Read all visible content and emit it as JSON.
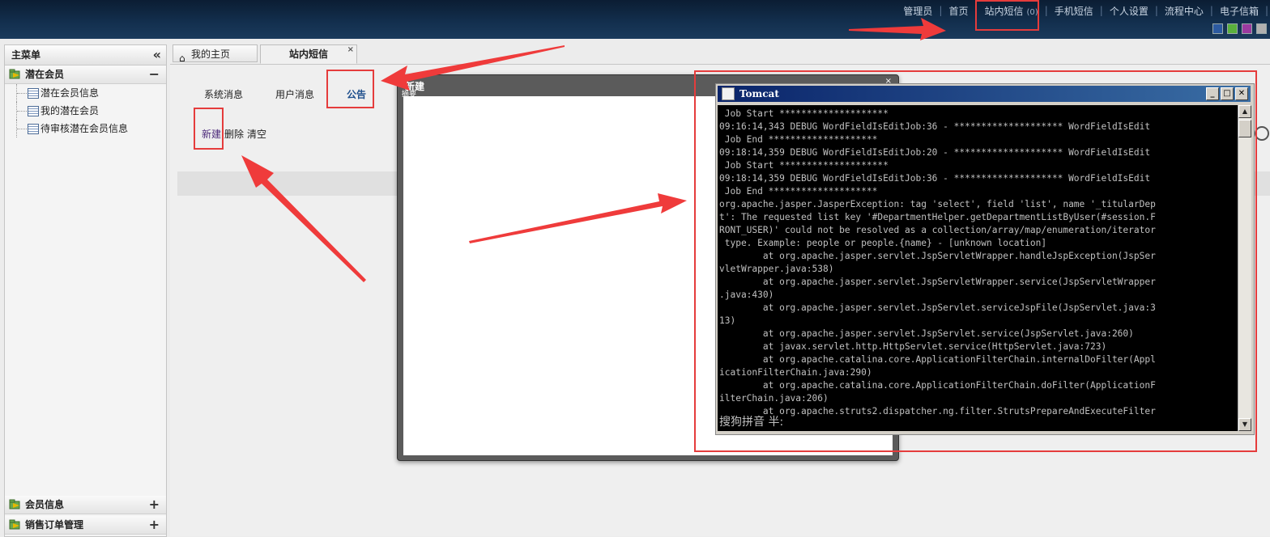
{
  "header": {
    "nav": [
      {
        "label": "管理员"
      },
      {
        "label": "首页"
      },
      {
        "label": "站内短信",
        "count": "(0)"
      },
      {
        "label": "手机短信"
      },
      {
        "label": "个人设置"
      },
      {
        "label": "流程中心"
      },
      {
        "label": "电子信箱"
      }
    ],
    "theme_colors": [
      "#2c5aa0",
      "#5ab03c",
      "#9b3aa0",
      "#b0b0b0"
    ]
  },
  "sidebar": {
    "title": "主菜单",
    "groups": [
      {
        "label": "潜在会员",
        "state": "−",
        "items": [
          {
            "label": "潜在会员信息"
          },
          {
            "label": "我的潜在会员"
          },
          {
            "label": "待审核潜在会员信息"
          }
        ]
      },
      {
        "label": "会员信息",
        "state": "+"
      },
      {
        "label": "销售订单管理",
        "state": "+"
      }
    ]
  },
  "tabs": [
    {
      "label": "我的主页"
    },
    {
      "label": "站内短信",
      "close": "×"
    }
  ],
  "message_tabs": [
    "系统消息",
    "用户消息",
    "公告"
  ],
  "actions": {
    "new": "新建",
    "delete": "删除",
    "clear": "清空"
  },
  "dialog": {
    "title": "新建",
    "subtitle": "摘要",
    "close": "×"
  },
  "console": {
    "title": "Tomcat",
    "lines": [
      " Job Start ********************",
      "09:16:14,343 DEBUG WordFieldIsEditJob:36 - ******************** WordFieldIsEdit",
      " Job End ********************",
      "09:18:14,359 DEBUG WordFieldIsEditJob:20 - ******************** WordFieldIsEdit",
      " Job Start ********************",
      "09:18:14,359 DEBUG WordFieldIsEditJob:36 - ******************** WordFieldIsEdit",
      " Job End ********************",
      "org.apache.jasper.JasperException: tag 'select', field 'list', name '_titularDep",
      "t': The requested list key '#DepartmentHelper.getDepartmentListByUser(#session.F",
      "RONT_USER)' could not be resolved as a collection/array/map/enumeration/iterator",
      " type. Example: people or people.{name} - [unknown location]",
      "        at org.apache.jasper.servlet.JspServletWrapper.handleJspException(JspSer",
      "vletWrapper.java:538)",
      "        at org.apache.jasper.servlet.JspServletWrapper.service(JspServletWrapper",
      ".java:430)",
      "        at org.apache.jasper.servlet.JspServlet.serviceJspFile(JspServlet.java:3",
      "13)",
      "        at org.apache.jasper.servlet.JspServlet.service(JspServlet.java:260)",
      "        at javax.servlet.http.HttpServlet.service(HttpServlet.java:723)",
      "        at org.apache.catalina.core.ApplicationFilterChain.internalDoFilter(Appl",
      "icationFilterChain.java:290)",
      "        at org.apache.catalina.core.ApplicationFilterChain.doFilter(ApplicationF",
      "ilterChain.java:206)",
      "        at org.apache.struts2.dispatcher.ng.filter.StrutsPrepareAndExecuteFilter"
    ],
    "ime": "搜狗拼音 半:"
  },
  "annotation_color": "#e53c3c"
}
